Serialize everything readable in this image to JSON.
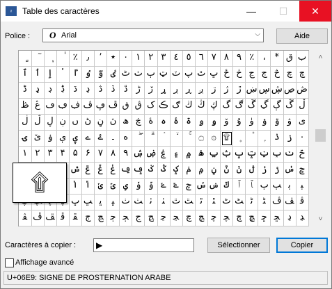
{
  "window": {
    "title": "Table des caractères",
    "icon_text": "ᵡ",
    "min_glyph": "—",
    "max_glyph": "☐",
    "close_glyph": "✕"
  },
  "font": {
    "label": "Police :",
    "value": "Arial",
    "font_icon": "O"
  },
  "help_button": "Aide",
  "grid": {
    "rows": [
      [
        "ٍ",
        "ٓ",
        "ٖ",
        "ٰ",
        "٪",
        "٫",
        "٬",
        "٭",
        "٠",
        "١",
        "٢",
        "٣",
        "٤",
        "٥",
        "٦",
        "٧",
        "٨",
        "٩",
        "٪",
        "،",
        "*",
        "ق",
        "ب"
      ],
      [
        "ٱ",
        "ٲ",
        "ٳ",
        "ٴ",
        "ٵ",
        "ٶ",
        "ٷ",
        "ٸ",
        "ٹ",
        "ٺ",
        "ٻ",
        "ټ",
        "ٽ",
        "پ",
        "ٿ",
        "ڀ",
        "ځ",
        "ڂ",
        "ڃ",
        "ڄ",
        "څ",
        "چ",
        "ڇ"
      ],
      [
        "ڈ",
        "ډ",
        "ڊ",
        "ڋ",
        "ڌ",
        "ڍ",
        "ڎ",
        "ڏ",
        "ڐ",
        "ڑ",
        "ڒ",
        "ړ",
        "ڔ",
        "ڕ",
        "ږ",
        "ڗ",
        "ژ",
        "ڙ",
        "ښ",
        "ڛ",
        "ڜ",
        "ڝ",
        "ڞ"
      ],
      [
        "ڟ",
        "ڠ",
        "ڡ",
        "ڢ",
        "ڣ",
        "ڤ",
        "ڥ",
        "ڦ",
        "ڧ",
        "ڨ",
        "ک",
        "ڪ",
        "ګ",
        "ڬ",
        "ڭ",
        "ڮ",
        "گ",
        "ڰ",
        "ڱ",
        "ڲ",
        "ڳ",
        "ڴ",
        "ڵ"
      ],
      [
        "ڶ",
        "ڷ",
        "ڸ",
        "ڹ",
        "ں",
        "ڻ",
        "ڼ",
        "ڽ",
        "ھ",
        "ڿ",
        "ۀ",
        "ہ",
        "ۂ",
        "ۃ",
        "ۄ",
        "ۅ",
        "ۆ",
        "ۇ",
        "ۈ",
        "ۉ",
        "ۊ",
        "ۋ",
        "ی"
      ],
      [
        "ۍ",
        "ێ",
        "ۏ",
        "ې",
        "ۑ",
        "ے",
        "ۓ",
        "۔",
        "ە",
        "ۖ",
        "ۗ",
        "ۘ",
        "ۙ",
        "ۚ",
        "۝",
        "۞",
        "۩",
        "۪",
        "۫",
        "ۭ",
        "ۮ",
        "ۯ",
        "۰"
      ],
      [
        "۱",
        "۲",
        "۳",
        "۴",
        "۵",
        "۶",
        "۷",
        "۸",
        "۹",
        "ۺ",
        "ۻ",
        "ۼ",
        "۽",
        "۾",
        "ۿ",
        "ݐ",
        "ݑ",
        "ݒ",
        "ݓ",
        "ݔ",
        "ݕ",
        "ݖ",
        "ݗ"
      ],
      [
        "ݘ",
        "ݙ",
        "ݚ",
        "ݛ",
        "ݜ",
        "ݝ",
        "ݞ",
        "ݟ",
        "ݠ",
        "ݡ",
        "ݢ",
        "ݣ",
        "ݤ",
        "ݥ",
        "ݦ",
        "ݧ",
        "ݨ",
        "ݩ",
        "ݪ",
        "ݫ",
        "ݬ",
        "ݭ",
        "ݮ"
      ],
      [
        "ݯ",
        "ݰ",
        "ݱ",
        "ݲ",
        "ݳ",
        "ݴ",
        "ݵ",
        "ݶ",
        "ݷ",
        "ݸ",
        "ݹ",
        "ݺ",
        "ݻ",
        "ݼ",
        "ݽ",
        "ݾ",
        "ݿ",
        "ﭐ",
        "ﭑ",
        "ﭒ",
        "ﭓ",
        "ﭔ",
        "ﭕ"
      ],
      [
        "ﭖ",
        "ﭗ",
        "ﭘ",
        "ﭙ",
        "ﭚ",
        "ﭛ",
        "ﭜ",
        "ﭝ",
        "ﭞ",
        "ﭟ",
        "ﭠ",
        "ﭡ",
        "ﭢ",
        "ﭣ",
        "ﭤ",
        "ﭥ",
        "ﭦ",
        "ﭧ",
        "ﭨ",
        "ﭩ",
        "ﭪ",
        "ﭫ",
        "ﭬ"
      ],
      [
        "ﭭ",
        "ﭮ",
        "ﭯ",
        "ﭰ",
        "ﭱ",
        "ﭲ",
        "ﭳ",
        "ﭴ",
        "ﭵ",
        "ﭶ",
        "ﭷ",
        "ﭸ",
        "ﭹ",
        "ﭺ",
        "ﭻ",
        "ﭼ",
        "ﭽ",
        "ﭾ",
        "ﭿ",
        "ﮀ",
        "ﮁ",
        "ﮂ",
        "ﮃ"
      ]
    ],
    "selected_row": 5,
    "selected_col": 16
  },
  "zoom_glyph": "۩",
  "copy": {
    "label": "Caractères à copier :",
    "value": "▶",
    "select_button": "Sélectionner",
    "copy_button": "Copier"
  },
  "advanced": {
    "label": "Affichage avancé",
    "checked": false
  },
  "status": "U+06E9: SIGNE DE PROSTERNATION ARABE"
}
